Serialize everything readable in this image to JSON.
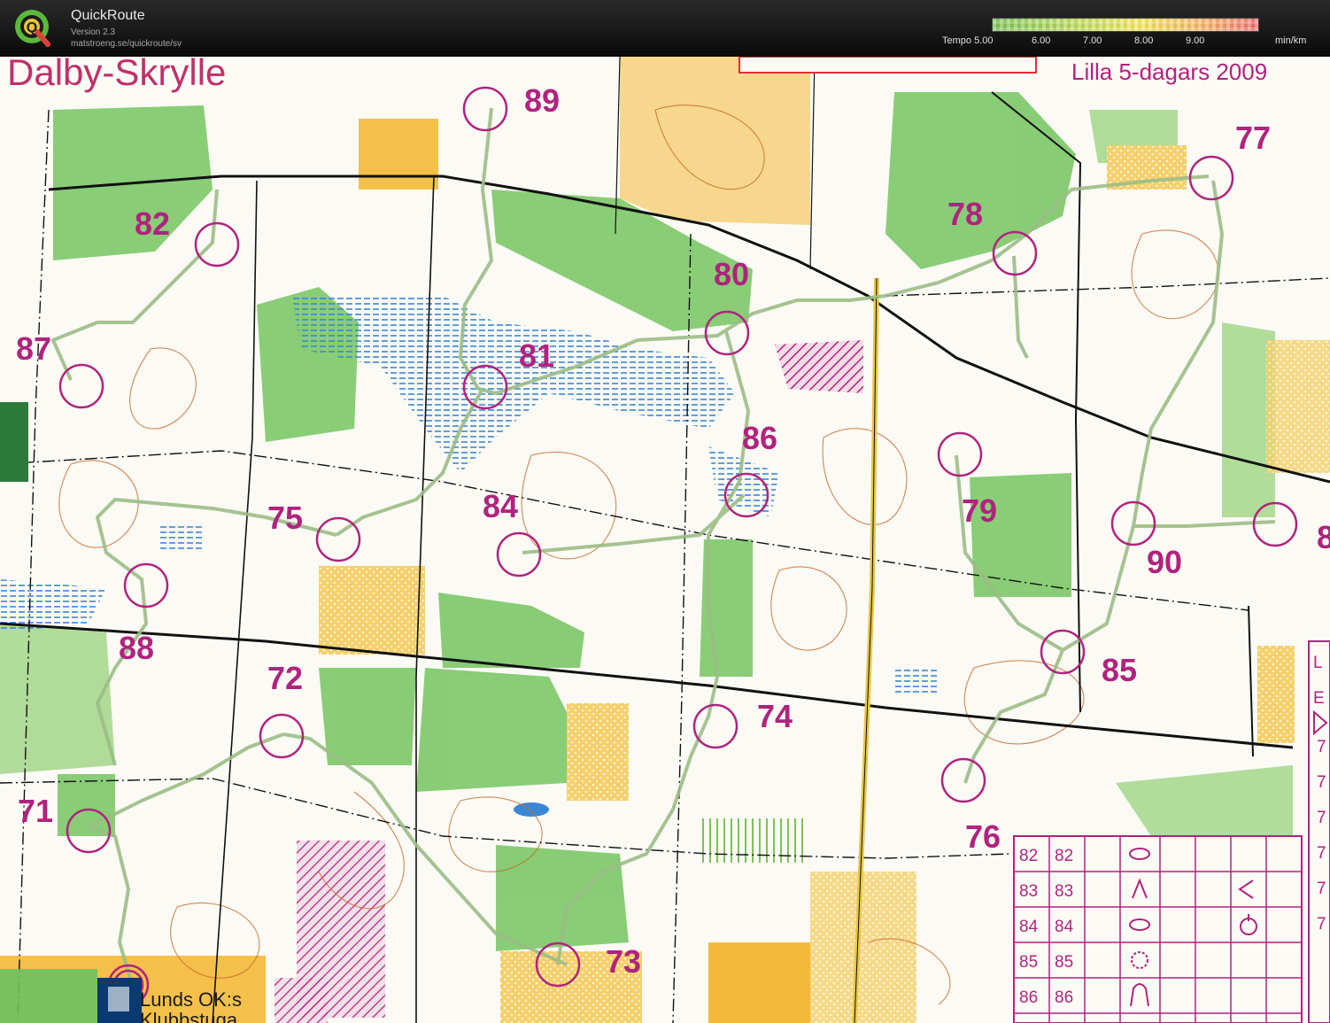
{
  "app": {
    "name": "QuickRoute",
    "version": "Version 2.3",
    "url": "matstroeng.se/quickroute/sv",
    "logo_letter": "Q"
  },
  "legend": {
    "prefix": "Tempo",
    "ticks": [
      "5.00",
      "6.00",
      "7.00",
      "8.00",
      "9.00"
    ],
    "unit": "min/km",
    "colors": [
      "#7cc25a",
      "#b8d85a",
      "#f0e65a",
      "#f3b067",
      "#ef6f6f"
    ]
  },
  "map": {
    "title": "Dalby-Skrylle",
    "event": "Lilla 5-dagars 2009",
    "club_line1": "Lunds OK:s",
    "club_line2": "Klubbstuga",
    "control_color": "#b0237e",
    "controls": [
      "89",
      "77",
      "82",
      "78",
      "80",
      "87",
      "81",
      "86",
      "79",
      "75",
      "84",
      "90",
      "88",
      "85",
      "72",
      "74",
      "71",
      "76",
      "73"
    ],
    "edge_fragment": "8",
    "side_letters": [
      "L",
      "E"
    ],
    "description_table": {
      "rows": [
        [
          "82",
          "82"
        ],
        [
          "83",
          "83"
        ],
        [
          "84",
          "84"
        ],
        [
          "85",
          "85"
        ],
        [
          "86",
          "86"
        ]
      ],
      "edge_digits": [
        "7",
        "7",
        "7",
        "7",
        "7",
        "7"
      ]
    }
  }
}
